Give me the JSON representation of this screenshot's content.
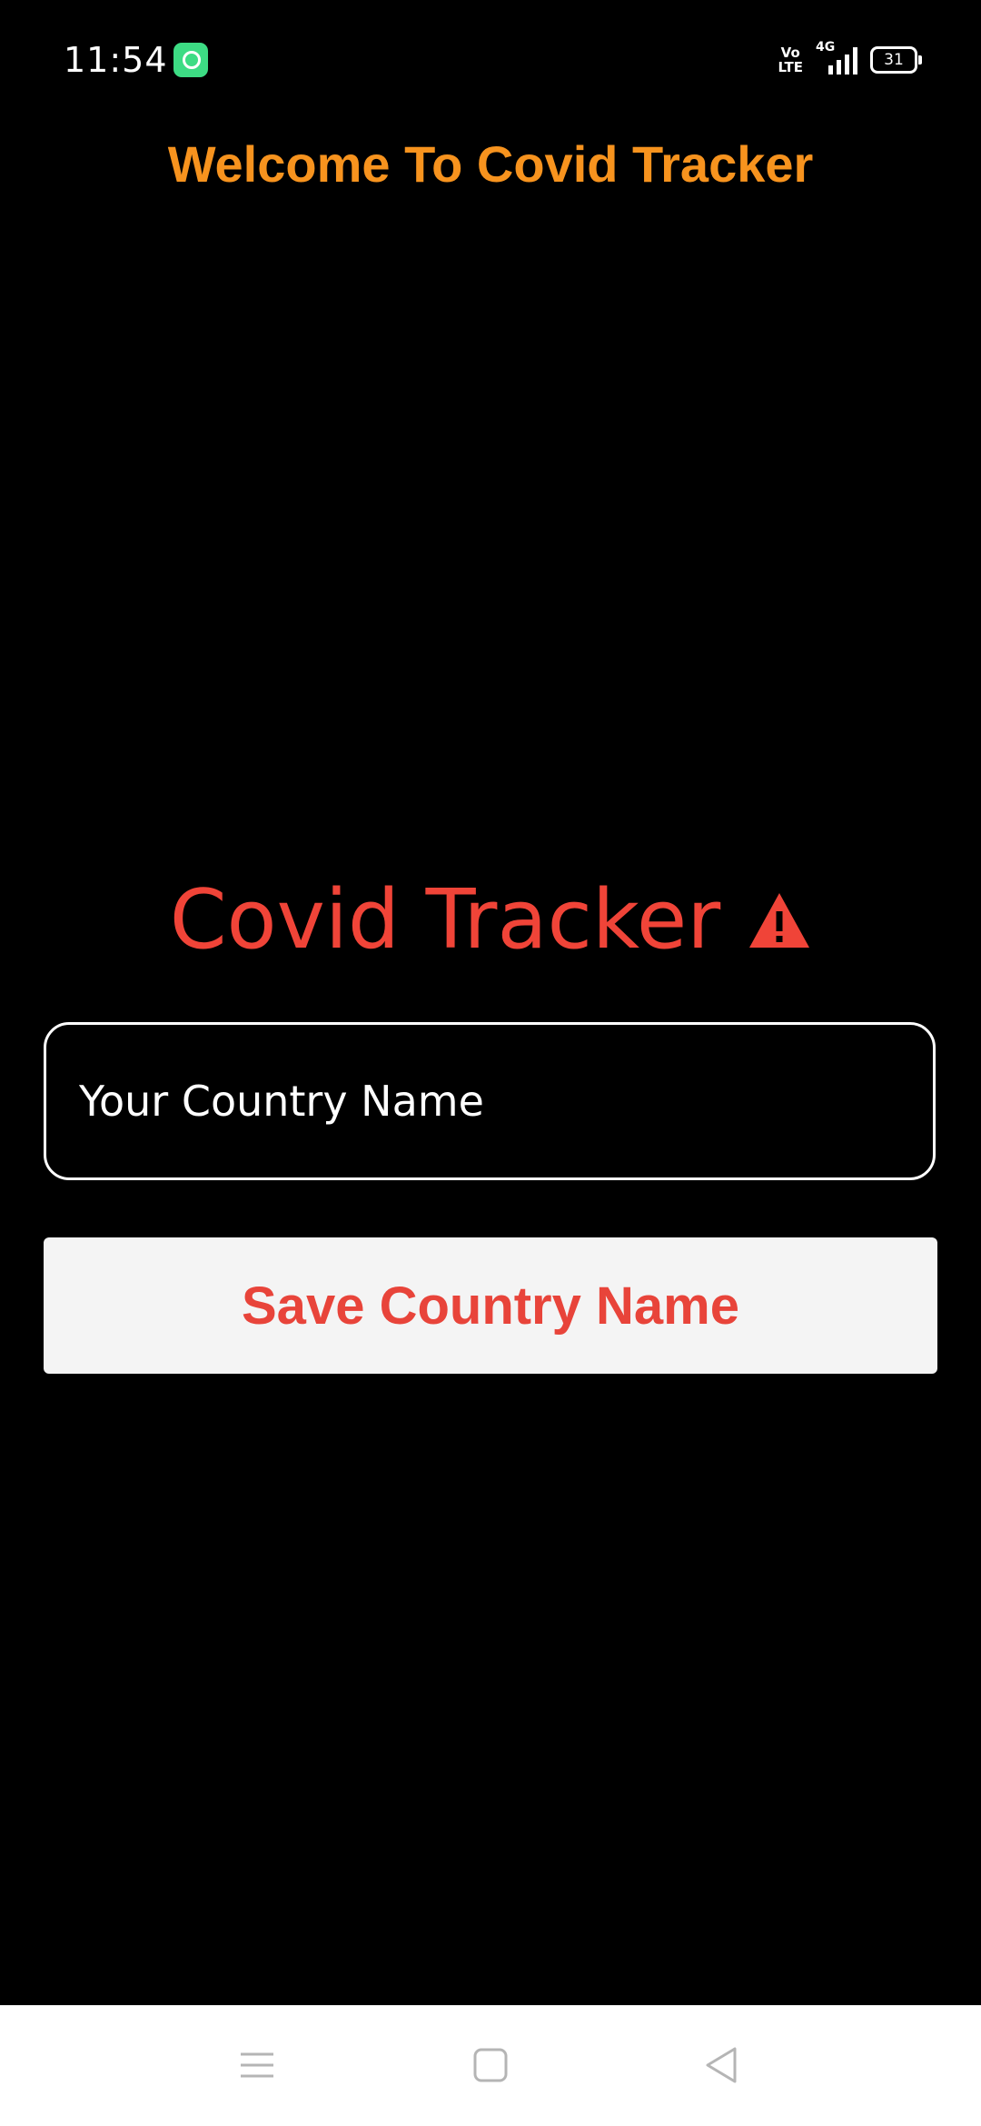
{
  "status_bar": {
    "time": "11:54",
    "network_label": "Vo\nLTE",
    "signal_label": "4G",
    "battery_level": "31"
  },
  "header": {
    "welcome_title": "Welcome To Covid Tracker"
  },
  "main": {
    "app_title": "Covid Tracker",
    "title_icon": "warning-icon",
    "country_input": {
      "value": "",
      "placeholder": "Your Country Name"
    },
    "save_button_label": "Save Country Name"
  },
  "nav_bar": {
    "icons": [
      "menu-icon",
      "home-icon",
      "back-icon"
    ]
  },
  "colors": {
    "background": "#000000",
    "welcome_title": "#f7931e",
    "accent_red": "#f04438",
    "button_bg": "#f4f4f4",
    "nav_bar_bg": "#ffffff"
  }
}
